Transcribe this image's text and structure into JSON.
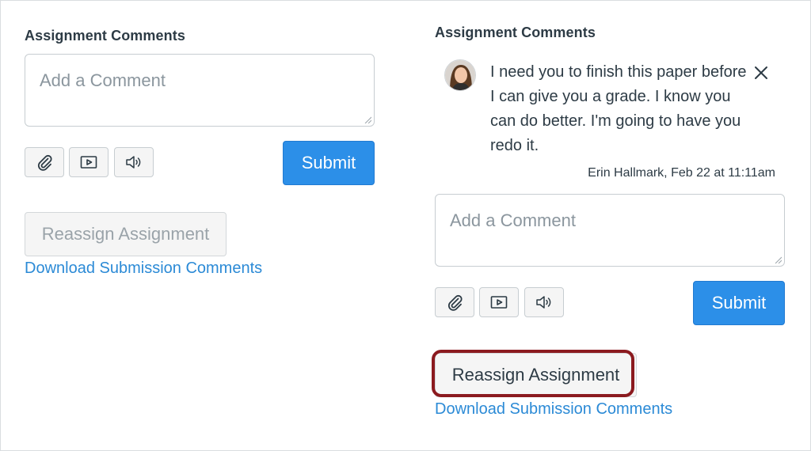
{
  "left_panel": {
    "heading": "Assignment Comments",
    "comment_placeholder": "Add a Comment",
    "submit_label": "Submit",
    "reassign_label": "Reassign Assignment",
    "download_label": "Download Submission Comments"
  },
  "right_panel": {
    "heading": "Assignment Comments",
    "comment": {
      "text": "I need you to finish this paper before I can give you a grade. I know you can do better. I'm going to have you redo it.",
      "meta": "Erin Hallmark, Feb 22 at 11:11am"
    },
    "comment_placeholder": "Add a Comment",
    "submit_label": "Submit",
    "reassign_label": "Reassign Assignment",
    "download_label": "Download Submission Comments"
  },
  "icons": [
    "paperclip-icon",
    "media-icon",
    "audio-icon",
    "close-icon",
    "resize-grip-icon"
  ],
  "colors": {
    "primary": "#2c8fe8",
    "link": "#2b8ad6",
    "highlight": "#8b1a1f",
    "text": "#2d3b45",
    "placeholder": "#8b969e"
  }
}
